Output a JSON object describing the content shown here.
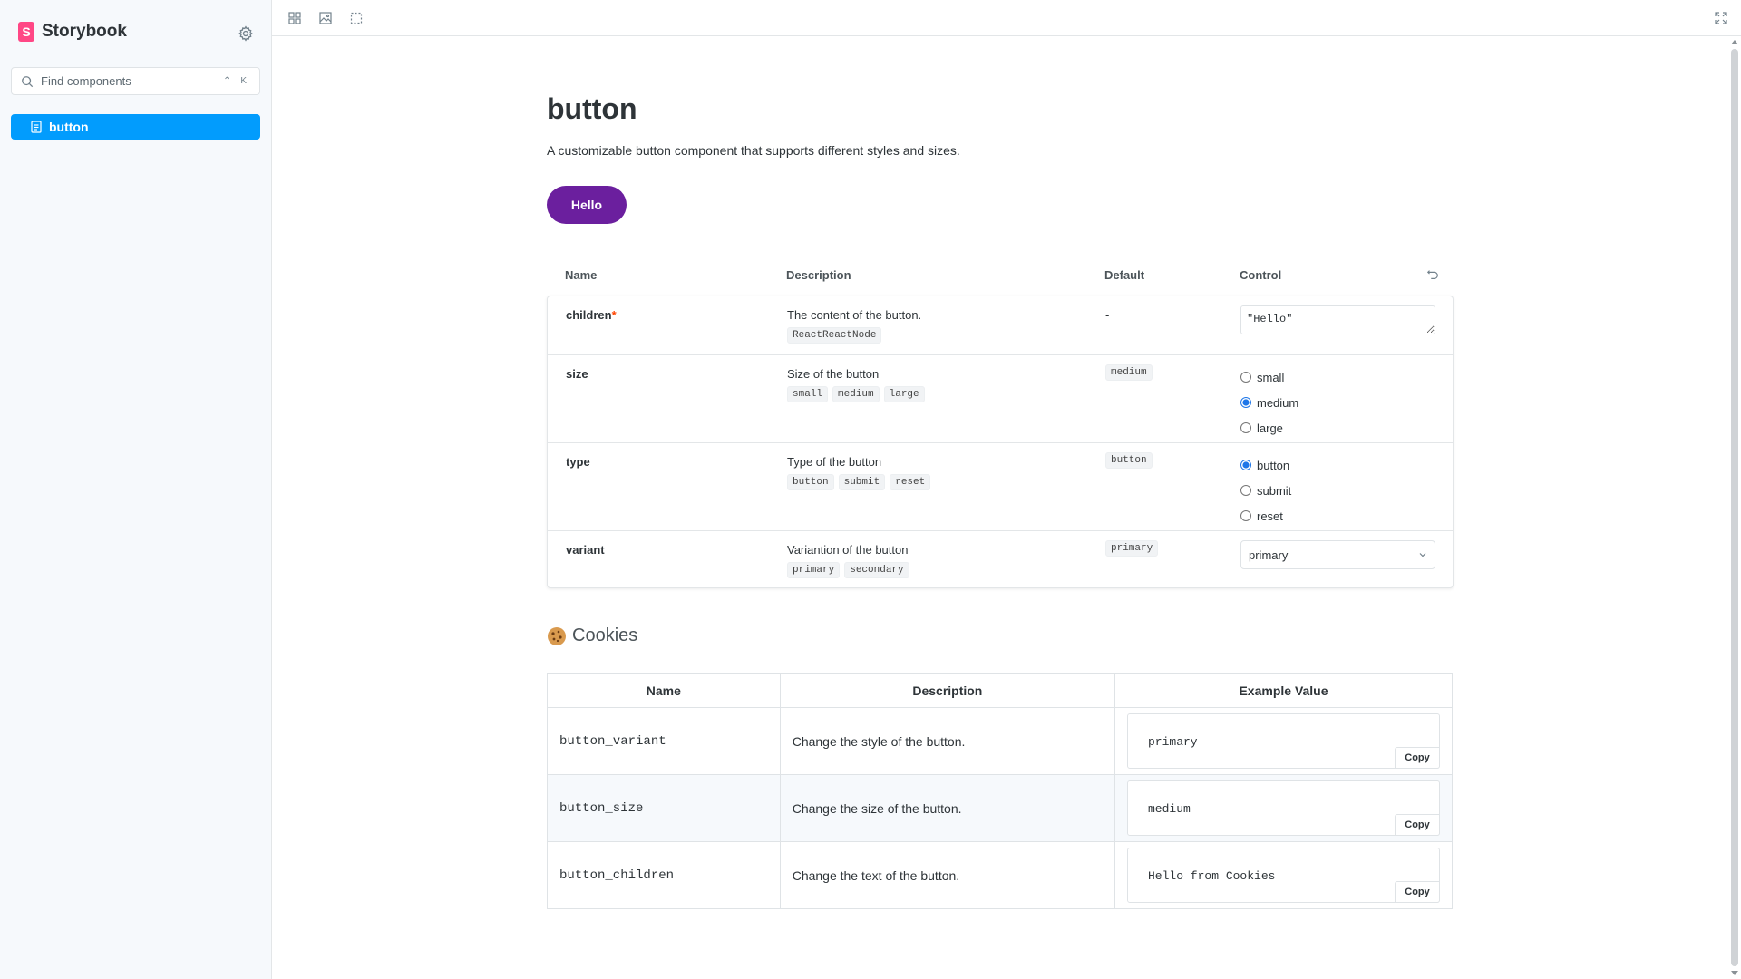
{
  "sidebar": {
    "brand": "Storybook",
    "search_placeholder": "Find components",
    "search_shortcut": "⌃ K",
    "items": [
      {
        "label": "button"
      }
    ]
  },
  "toolbar": {
    "tools": [
      "grid-icon",
      "image-icon",
      "outline-icon"
    ],
    "fullscreen_icon": "expand-icon"
  },
  "main": {
    "title": "button",
    "description": "A customizable button component that supports different styles and sizes.",
    "demo_button": "Hello",
    "demo_button_color": "#6b1f9e"
  },
  "argtable": {
    "headers": {
      "name": "Name",
      "description": "Description",
      "default": "Default",
      "control": "Control"
    },
    "rows": [
      {
        "name": "children",
        "required": "*",
        "description": "The content of the button.",
        "types": [
          "ReactReactNode"
        ],
        "default": "-",
        "control_value": "\"Hello\""
      },
      {
        "name": "size",
        "description": "Size of the button",
        "types": [
          "small",
          "medium",
          "large"
        ],
        "default": "medium",
        "options": [
          "small",
          "medium",
          "large"
        ],
        "selected": "medium"
      },
      {
        "name": "type",
        "description": "Type of the button",
        "types": [
          "button",
          "submit",
          "reset"
        ],
        "default": "button",
        "options": [
          "button",
          "submit",
          "reset"
        ],
        "selected": "button"
      },
      {
        "name": "variant",
        "description": "Variantion of the button",
        "types": [
          "primary",
          "secondary"
        ],
        "default": "primary",
        "selected": "primary"
      }
    ]
  },
  "cookies": {
    "title": "Cookies",
    "headers": [
      "Name",
      "Description",
      "Example Value"
    ],
    "rows": [
      {
        "name": "button_variant",
        "description": "Change the style of the button.",
        "value": "primary"
      },
      {
        "name": "button_size",
        "description": "Change the size of the button.",
        "value": "medium"
      },
      {
        "name": "button_children",
        "description": "Change the text of the button.",
        "value": "Hello from Cookies"
      }
    ],
    "copy_label": "Copy"
  },
  "colors": {
    "accent": "#029cfd",
    "brand": "#ff4785"
  }
}
